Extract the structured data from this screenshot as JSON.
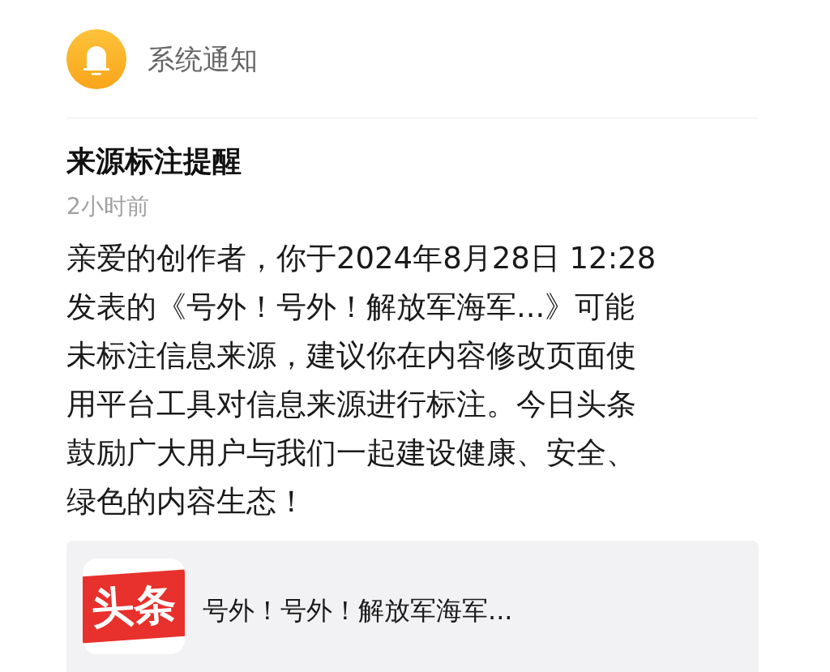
{
  "header": {
    "title": "系统通知"
  },
  "notice": {
    "title": "来源标注提醒",
    "time": "2小时前",
    "body_lines": [
      "亲爱的创作者，你于2024年8月28日 12:28",
      "发表的《号外！号外！解放军海军...》可能",
      "未标注信息来源，建议你在内容修改页面使",
      "用平台工具对信息来源进行标注。今日头条",
      "鼓励广大用户与我们一起建设健康、安全、",
      "绿色的内容生态！"
    ]
  },
  "article": {
    "logo_text": "头条",
    "title": "号外！号外！解放军海军..."
  }
}
